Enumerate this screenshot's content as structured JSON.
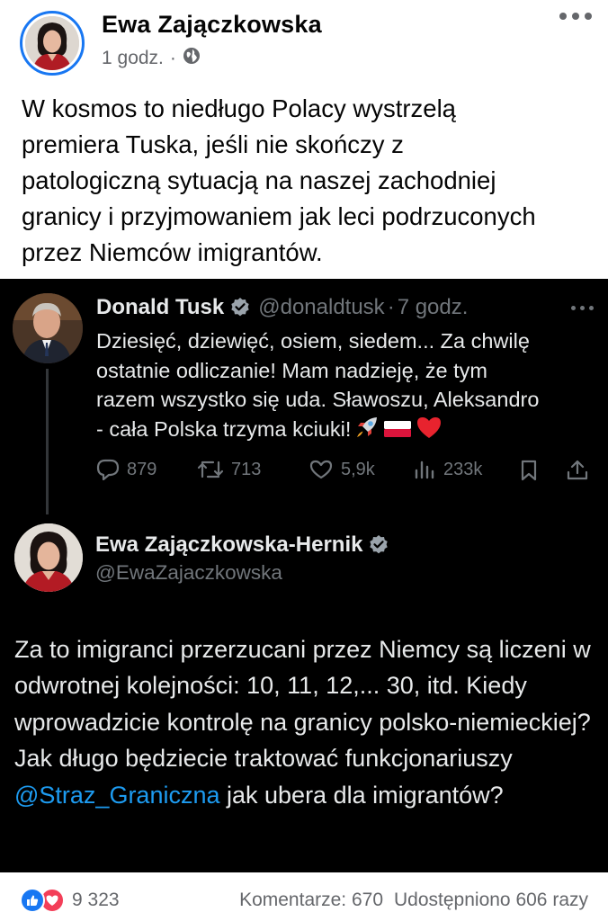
{
  "post": {
    "author": "Ewa Zajączkowska",
    "time": "1 godz.",
    "separator": "·",
    "audience_icon": "globe-icon",
    "text": "W kosmos to niedługo Polacy wystrzelą\npremiera Tuska, jeśli nie skończy z\npatologiczną sytuacją na naszej zachodniej\ngranicy i przyjmowaniem jak leci podrzuconych\nprzez Niemców imigrantów."
  },
  "tweet1": {
    "name": "Donald Tusk",
    "handle": "@donaldtusk",
    "sep": "·",
    "time": "7 godz.",
    "text": "Dziesięć, dziewięć, osiem, siedem... Za chwilę\nostatnie odliczanie! Mam nadzieję, że tym\nrazem wszystko się uda. Sławoszu, Aleksandro\n- cała Polska trzyma kciuki!",
    "emojis": [
      "rocket-emoji",
      "poland-flag-emoji",
      "red-heart-emoji"
    ],
    "replies": "879",
    "retweets": "713",
    "likes": "5,9k",
    "views": "233k"
  },
  "tweet2": {
    "name": "Ewa Zajączkowska-Hernik",
    "handle": "@EwaZajaczkowska",
    "text_before": "Za to imigranci przerzucani przez Niemcy są liczeni w odwrotnej kolejności: 10, 11, 12,... 30, itd. Kiedy wprowadzicie kontrolę na granicy polsko-niemieckiej? Jak długo będziecie traktować funkcjonariuszy ",
    "mention": "@Straz_Graniczna",
    "text_after": " jak ubera dla imigrantów?"
  },
  "footer": {
    "reaction_count": "9 323",
    "comments": "Komentarze: 670",
    "shares": "Udostępniono 606 razy"
  },
  "colors": {
    "facebook_blue": "#1877f2",
    "twitter_blue": "#1d9bf0",
    "dark_bg": "#000000",
    "love_red": "#f33e58"
  }
}
